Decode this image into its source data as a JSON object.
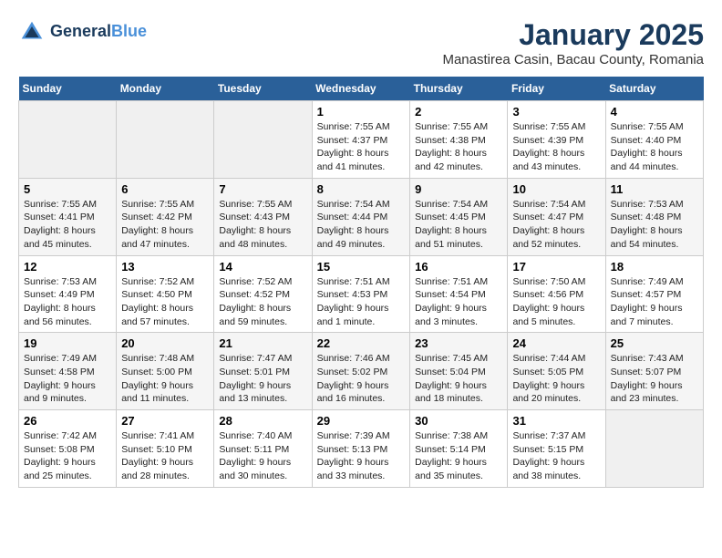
{
  "logo": {
    "line1": "General",
    "line2": "Blue"
  },
  "title": "January 2025",
  "subtitle": "Manastirea Casin, Bacau County, Romania",
  "weekdays": [
    "Sunday",
    "Monday",
    "Tuesday",
    "Wednesday",
    "Thursday",
    "Friday",
    "Saturday"
  ],
  "weeks": [
    [
      {
        "day": "",
        "info": ""
      },
      {
        "day": "",
        "info": ""
      },
      {
        "day": "",
        "info": ""
      },
      {
        "day": "1",
        "info": "Sunrise: 7:55 AM\nSunset: 4:37 PM\nDaylight: 8 hours and 41 minutes."
      },
      {
        "day": "2",
        "info": "Sunrise: 7:55 AM\nSunset: 4:38 PM\nDaylight: 8 hours and 42 minutes."
      },
      {
        "day": "3",
        "info": "Sunrise: 7:55 AM\nSunset: 4:39 PM\nDaylight: 8 hours and 43 minutes."
      },
      {
        "day": "4",
        "info": "Sunrise: 7:55 AM\nSunset: 4:40 PM\nDaylight: 8 hours and 44 minutes."
      }
    ],
    [
      {
        "day": "5",
        "info": "Sunrise: 7:55 AM\nSunset: 4:41 PM\nDaylight: 8 hours and 45 minutes."
      },
      {
        "day": "6",
        "info": "Sunrise: 7:55 AM\nSunset: 4:42 PM\nDaylight: 8 hours and 47 minutes."
      },
      {
        "day": "7",
        "info": "Sunrise: 7:55 AM\nSunset: 4:43 PM\nDaylight: 8 hours and 48 minutes."
      },
      {
        "day": "8",
        "info": "Sunrise: 7:54 AM\nSunset: 4:44 PM\nDaylight: 8 hours and 49 minutes."
      },
      {
        "day": "9",
        "info": "Sunrise: 7:54 AM\nSunset: 4:45 PM\nDaylight: 8 hours and 51 minutes."
      },
      {
        "day": "10",
        "info": "Sunrise: 7:54 AM\nSunset: 4:47 PM\nDaylight: 8 hours and 52 minutes."
      },
      {
        "day": "11",
        "info": "Sunrise: 7:53 AM\nSunset: 4:48 PM\nDaylight: 8 hours and 54 minutes."
      }
    ],
    [
      {
        "day": "12",
        "info": "Sunrise: 7:53 AM\nSunset: 4:49 PM\nDaylight: 8 hours and 56 minutes."
      },
      {
        "day": "13",
        "info": "Sunrise: 7:52 AM\nSunset: 4:50 PM\nDaylight: 8 hours and 57 minutes."
      },
      {
        "day": "14",
        "info": "Sunrise: 7:52 AM\nSunset: 4:52 PM\nDaylight: 8 hours and 59 minutes."
      },
      {
        "day": "15",
        "info": "Sunrise: 7:51 AM\nSunset: 4:53 PM\nDaylight: 9 hours and 1 minute."
      },
      {
        "day": "16",
        "info": "Sunrise: 7:51 AM\nSunset: 4:54 PM\nDaylight: 9 hours and 3 minutes."
      },
      {
        "day": "17",
        "info": "Sunrise: 7:50 AM\nSunset: 4:56 PM\nDaylight: 9 hours and 5 minutes."
      },
      {
        "day": "18",
        "info": "Sunrise: 7:49 AM\nSunset: 4:57 PM\nDaylight: 9 hours and 7 minutes."
      }
    ],
    [
      {
        "day": "19",
        "info": "Sunrise: 7:49 AM\nSunset: 4:58 PM\nDaylight: 9 hours and 9 minutes."
      },
      {
        "day": "20",
        "info": "Sunrise: 7:48 AM\nSunset: 5:00 PM\nDaylight: 9 hours and 11 minutes."
      },
      {
        "day": "21",
        "info": "Sunrise: 7:47 AM\nSunset: 5:01 PM\nDaylight: 9 hours and 13 minutes."
      },
      {
        "day": "22",
        "info": "Sunrise: 7:46 AM\nSunset: 5:02 PM\nDaylight: 9 hours and 16 minutes."
      },
      {
        "day": "23",
        "info": "Sunrise: 7:45 AM\nSunset: 5:04 PM\nDaylight: 9 hours and 18 minutes."
      },
      {
        "day": "24",
        "info": "Sunrise: 7:44 AM\nSunset: 5:05 PM\nDaylight: 9 hours and 20 minutes."
      },
      {
        "day": "25",
        "info": "Sunrise: 7:43 AM\nSunset: 5:07 PM\nDaylight: 9 hours and 23 minutes."
      }
    ],
    [
      {
        "day": "26",
        "info": "Sunrise: 7:42 AM\nSunset: 5:08 PM\nDaylight: 9 hours and 25 minutes."
      },
      {
        "day": "27",
        "info": "Sunrise: 7:41 AM\nSunset: 5:10 PM\nDaylight: 9 hours and 28 minutes."
      },
      {
        "day": "28",
        "info": "Sunrise: 7:40 AM\nSunset: 5:11 PM\nDaylight: 9 hours and 30 minutes."
      },
      {
        "day": "29",
        "info": "Sunrise: 7:39 AM\nSunset: 5:13 PM\nDaylight: 9 hours and 33 minutes."
      },
      {
        "day": "30",
        "info": "Sunrise: 7:38 AM\nSunset: 5:14 PM\nDaylight: 9 hours and 35 minutes."
      },
      {
        "day": "31",
        "info": "Sunrise: 7:37 AM\nSunset: 5:15 PM\nDaylight: 9 hours and 38 minutes."
      },
      {
        "day": "",
        "info": ""
      }
    ]
  ]
}
